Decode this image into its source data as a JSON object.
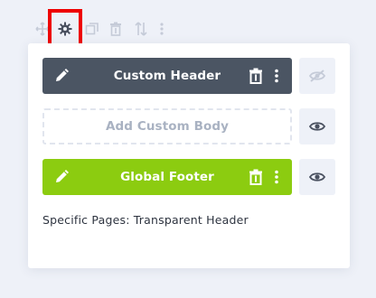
{
  "toolbar": {
    "icons": [
      "move-icon",
      "gear-icon",
      "duplicate-icon",
      "trash-icon",
      "sort-icon",
      "more-vertical-icon"
    ],
    "highlight_color": "#ee0000"
  },
  "layouts": {
    "header": {
      "label": "Custom Header",
      "bg": "#4b5563",
      "visible": false
    },
    "body": {
      "label": "Add Custom Body",
      "visible": true
    },
    "footer": {
      "label": "Global Footer",
      "bg": "#8ccc10",
      "visible": true
    }
  },
  "assignment": "Specific Pages: Transparent Header"
}
